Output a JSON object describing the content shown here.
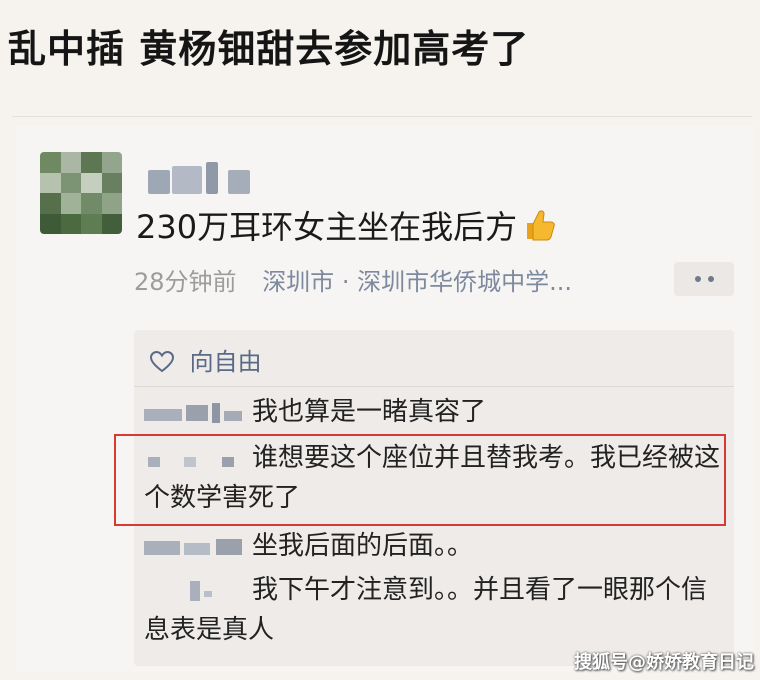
{
  "article": {
    "title": "乱中插 黄杨钿甜去参加高考了"
  },
  "post": {
    "text": "230万耳环女主坐在我后方",
    "emoji": "thumbs-up-icon",
    "time": "28分钟前",
    "location": "深圳市 · 深圳市华侨城中学..."
  },
  "comments": {
    "liked_by": "向自由",
    "items": [
      {
        "text": "我也算是一睹真容了"
      },
      {
        "text": "谁想要这个座位并且替我考。我已经被这个数学害死了"
      },
      {
        "text": "坐我后面的后面。。"
      },
      {
        "text": "我下午才注意到。。并且看了一眼那个信息表是真人"
      }
    ]
  },
  "watermark": "搜狐号@娇娇教育日记",
  "colors": {
    "background": "#f6f3ef",
    "comment_box": "#eeebe8",
    "location_text": "#7d8a9e",
    "highlight": "#d53a35"
  }
}
